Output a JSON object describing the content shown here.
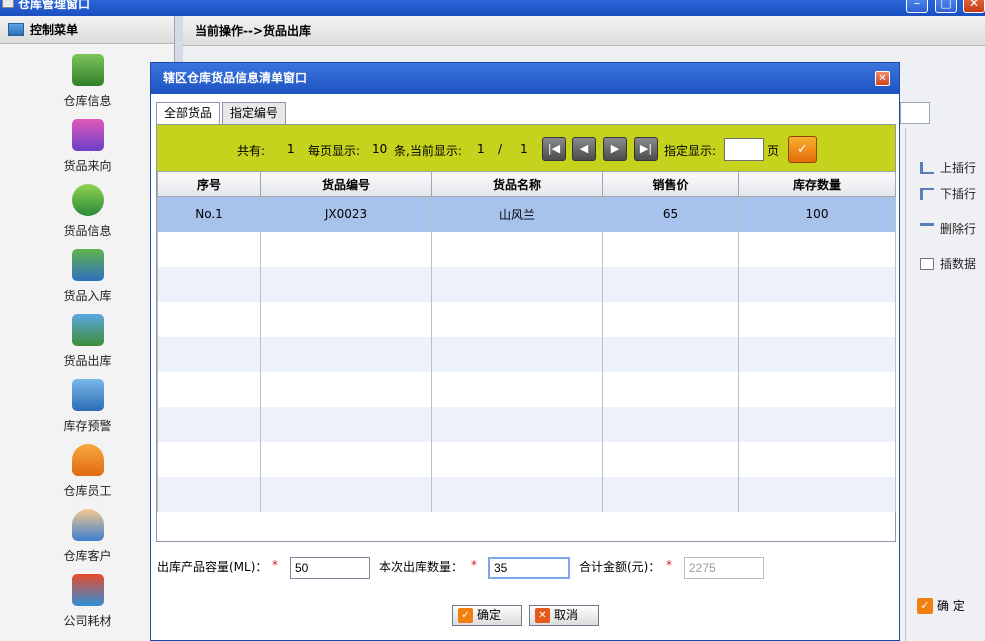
{
  "window": {
    "title": "仓库管理窗口"
  },
  "sidebar": {
    "header": "控制菜单",
    "items": [
      {
        "label": "仓库信息",
        "icon": "warehouse-icon"
      },
      {
        "label": "货品来向",
        "icon": "goods-source-icon"
      },
      {
        "label": "货品信息",
        "icon": "goods-info-icon"
      },
      {
        "label": "货品入库",
        "icon": "goods-in-icon"
      },
      {
        "label": "货品出库",
        "icon": "goods-out-icon"
      },
      {
        "label": "库存预警",
        "icon": "stock-alert-icon"
      },
      {
        "label": "仓库员工",
        "icon": "staff-icon"
      },
      {
        "label": "仓库客户",
        "icon": "customer-icon"
      },
      {
        "label": "公司耗材",
        "icon": "supplies-icon"
      }
    ]
  },
  "main": {
    "breadcrumb": "当前操作-->货品出库",
    "tools": [
      {
        "label": "上插行",
        "icon": "insert-above-icon"
      },
      {
        "label": "下插行",
        "icon": "insert-below-icon"
      },
      {
        "label": "删除行",
        "icon": "delete-row-icon"
      },
      {
        "label": "插数据",
        "icon": "insert-data-icon"
      }
    ],
    "confirm_label": "确 定"
  },
  "dialog": {
    "title": "辖区仓库货品信息清单窗口",
    "tabs": [
      {
        "label": "全部货品",
        "active": true
      },
      {
        "label": "指定编号",
        "active": false
      }
    ],
    "pager": {
      "total_label": "共有:",
      "total": "1",
      "per_page_label": "每页显示:",
      "per_page": "10",
      "per_page_suffix": "条,当前显示:",
      "current_page": "1",
      "separator": "/",
      "total_pages": "1",
      "goto_label": "指定显示:",
      "goto_value": "",
      "page_unit": "页"
    },
    "table": {
      "columns": [
        "序号",
        "货品编号",
        "货品名称",
        "销售价",
        "库存数量"
      ],
      "rows": [
        [
          "No.1",
          "JX0023",
          "山风兰",
          "65",
          "100"
        ]
      ]
    },
    "form": {
      "capacity_label": "出库产品容量(ML)：",
      "capacity_value": "50",
      "quantity_label": "本次出库数量：",
      "quantity_value": "35",
      "total_label": "合计金额(元)：",
      "total_value": "2275",
      "required_mark": "*"
    },
    "buttons": {
      "ok": "确定",
      "cancel": "取消"
    }
  }
}
